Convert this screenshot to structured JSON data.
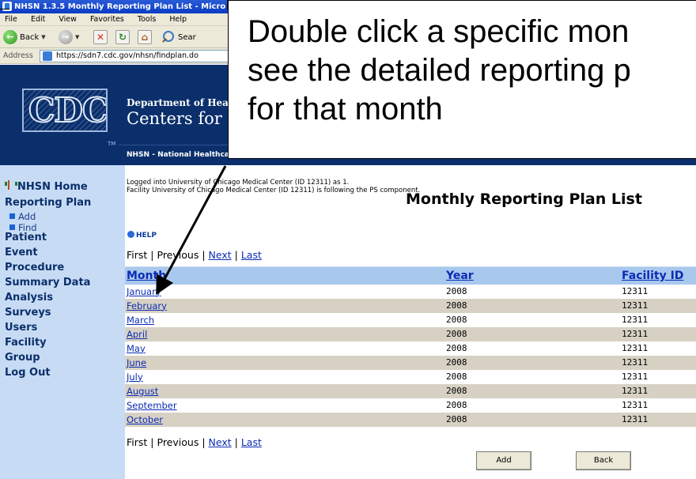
{
  "window": {
    "title": "NHSN 1.3.5 Monthly Reporting Plan List - Micro"
  },
  "menubar": [
    "File",
    "Edit",
    "View",
    "Favorites",
    "Tools",
    "Help"
  ],
  "toolbar": {
    "back_label": "Back",
    "search_label": "Sear"
  },
  "address": {
    "label": "Address",
    "url": "https://sdn7.cdc.gov/nhsn/findplan.do"
  },
  "header": {
    "logo_text": "CDC",
    "dept_text": "Department of Health",
    "centers_text": "Centers for D",
    "nhsn_text": "NHSN - National Healthcar"
  },
  "sidebar": {
    "home": "NHSN Home",
    "items": [
      "Reporting Plan",
      "Patient",
      "Event",
      "Procedure",
      "Summary Data",
      "Analysis",
      "Surveys",
      "Users",
      "Facility",
      "Group",
      "Log Out"
    ],
    "subitems": [
      "Add",
      "Find"
    ]
  },
  "main": {
    "login_line1": "Logged into University of Chicago Medical Center (ID 12311) as 1.",
    "login_line2": "Facility University of Chicago Medical Center (ID 12311) is following the PS component.",
    "heading": "Monthly Reporting Plan List",
    "help_label": "HELP",
    "pager": {
      "first": "First",
      "previous": "Previous",
      "next": "Next",
      "last": "Last",
      "sep": "|"
    },
    "table": {
      "headers": [
        "Month",
        "Year",
        "Facility ID"
      ],
      "rows": [
        [
          "January",
          "2008",
          "12311"
        ],
        [
          "February",
          "2008",
          "12311"
        ],
        [
          "March",
          "2008",
          "12311"
        ],
        [
          "April",
          "2008",
          "12311"
        ],
        [
          "May",
          "2008",
          "12311"
        ],
        [
          "June",
          "2008",
          "12311"
        ],
        [
          "July",
          "2008",
          "12311"
        ],
        [
          "August",
          "2008",
          "12311"
        ],
        [
          "September",
          "2008",
          "12311"
        ],
        [
          "October",
          "2008",
          "12311"
        ]
      ]
    },
    "buttons": {
      "add": "Add",
      "back": "Back"
    }
  },
  "callout": {
    "line1": "Double click a specific mon",
    "line2": "see the detailed reporting p",
    "line3": "for that month"
  },
  "colors": {
    "cdc_navy": "#0b2f6b",
    "sidebar_bg": "#c7dcf4",
    "table_header": "#a9c8ed",
    "row_alt": "#d7d1c4",
    "link": "#0a2cb5"
  }
}
